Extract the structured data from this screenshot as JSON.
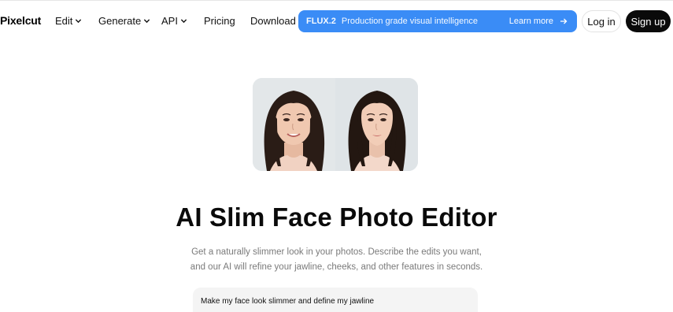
{
  "nav": {
    "logo": "Pixelcut",
    "items": [
      {
        "label": "Edit",
        "has_dropdown": true
      },
      {
        "label": "Generate",
        "has_dropdown": true
      },
      {
        "label": "API",
        "has_dropdown": true
      },
      {
        "label": "Pricing",
        "has_dropdown": false
      },
      {
        "label": "Download",
        "has_dropdown": false
      }
    ],
    "promo": {
      "tag": "FLUX.2",
      "text": "Production grade visual intelligence",
      "cta": "Learn more",
      "color": "#3a8cf6"
    },
    "login": "Log in",
    "signup": "Sign up"
  },
  "hero": {
    "title": "AI Slim Face Photo Editor",
    "subtitle_line1": "Get a naturally slimmer look in your photos. Describe the edits you want,",
    "subtitle_line2": "and our AI will refine your jawline, cheeks, and other features in seconds."
  },
  "prompt": {
    "value": "Make my face look slimmer and define my jawline"
  }
}
